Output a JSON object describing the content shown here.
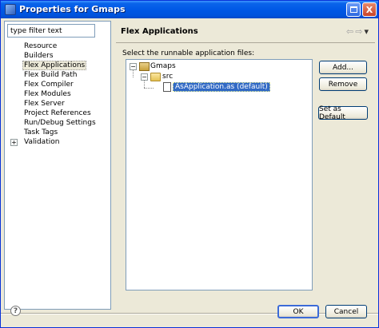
{
  "window": {
    "title": "Properties for Gmaps",
    "maximize_icon": "maximize-icon",
    "close_icon": "close-icon",
    "close_glyph": "X"
  },
  "sidebar": {
    "filter_placeholder": "type filter text",
    "items": [
      {
        "label": "Resource",
        "expandable": false,
        "selected": false
      },
      {
        "label": "Builders",
        "expandable": false,
        "selected": false
      },
      {
        "label": "Flex Applications",
        "expandable": false,
        "selected": true
      },
      {
        "label": "Flex Build Path",
        "expandable": false,
        "selected": false
      },
      {
        "label": "Flex Compiler",
        "expandable": false,
        "selected": false
      },
      {
        "label": "Flex Modules",
        "expandable": false,
        "selected": false
      },
      {
        "label": "Flex Server",
        "expandable": false,
        "selected": false
      },
      {
        "label": "Project References",
        "expandable": false,
        "selected": false
      },
      {
        "label": "Run/Debug Settings",
        "expandable": false,
        "selected": false
      },
      {
        "label": "Task Tags",
        "expandable": false,
        "selected": false
      },
      {
        "label": "Validation",
        "expandable": true,
        "selected": false
      }
    ],
    "expand_glyph": "+"
  },
  "page": {
    "title": "Flex Applications",
    "prompt": "Select the runnable application files:",
    "nav_back_glyph": "⇦",
    "nav_forward_glyph": "⇨",
    "nav_menu_glyph": "▾",
    "tree": {
      "project": "Gmaps",
      "folder": "src",
      "file": "AsApplication.as (default)",
      "collapse_glyph": "−"
    },
    "buttons": {
      "add": "Add...",
      "remove": "Remove",
      "set_default": "Set as Default"
    }
  },
  "footer": {
    "help_glyph": "?",
    "ok": "OK",
    "cancel": "Cancel"
  },
  "colors": {
    "titlebar": "#0058e6",
    "selection": "#316ac5",
    "dialog_bg": "#ece9d8"
  }
}
